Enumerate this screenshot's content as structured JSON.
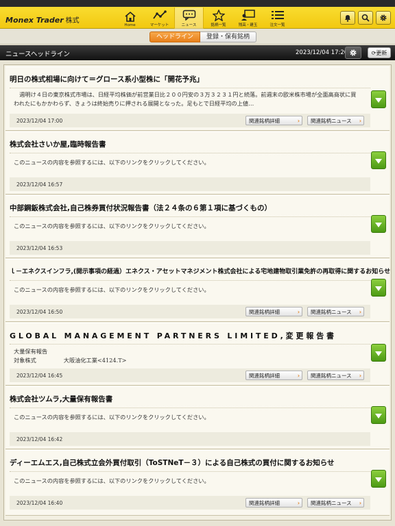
{
  "app": {
    "brand": "Monex Trader",
    "brand_sub": "株式"
  },
  "nav": [
    {
      "label": "Home",
      "icon": "home-icon"
    },
    {
      "label": "マーケット",
      "icon": "chart-line-icon"
    },
    {
      "label": "ニュース",
      "icon": "speech-bubble-icon",
      "active": true
    },
    {
      "label": "銘柄一覧",
      "icon": "star-icon"
    },
    {
      "label": "残高・建玉",
      "icon": "portfolio-icon"
    },
    {
      "label": "注文一覧",
      "icon": "list-icon"
    }
  ],
  "tools": [
    "bell-icon",
    "search-icon",
    "gear-icon"
  ],
  "subtabs": [
    "ヘッドライン",
    "登録・保有銘柄"
  ],
  "header": {
    "title": "ニュースヘッドライン",
    "time": "2023/12/04 17:20",
    "refresh": "更新"
  },
  "buttons": {
    "detail": "関連銘柄詳細",
    "news": "関連銘柄ニュース"
  },
  "news": [
    {
      "title": "明日の株式相場に向けて＝グロース系小型株に「開花予兆」",
      "body": "　週明け４日の東京株式市場は、日経平均株価が前営業日比２００円安の３万３２３１円と続落。前週末の欧米株市場が全面高商状に買われたにもかかわらず、きょうは終始売りに押される展開となった。足もとで日経平均の上値…",
      "time": "2023/12/04 17:00",
      "links": true
    },
    {
      "title": "株式会社さいか屋,臨時報告書",
      "body": "このニュースの内容を参照するには、以下のリンクをクリックしてください。",
      "time": "2023/12/04 16:57",
      "links": false
    },
    {
      "title": "中部鋼鈑株式会社,自己株券買付状況報告書（法２４条の６第１項に基づくもの）",
      "body": "このニュースの内容を参照するには、以下のリンクをクリックしてください。",
      "time": "2023/12/04 16:53",
      "links": false
    },
    {
      "title": "ｌ－エネクスインフラ,(開示事項の経過）エネクス・アセットマネジメント株式会社による宅地建物取引業免許の再取得に関するお知らせ",
      "body": "このニュースの内容を参照するには、以下のリンクをクリックしてください。",
      "time": "2023/12/04 16:50",
      "links": true
    },
    {
      "title": "GLOBAL MANAGEMENT PARTNERS LIMITED,変更報告書",
      "body_heading": "大量保有報告",
      "body_label": "対象株式",
      "body_value": "大阪油化工業<4124.T>",
      "time": "2023/12/04 16:45",
      "links": true
    },
    {
      "title": "株式会社ツムラ,大量保有報告書",
      "body": "このニュースの内容を参照するには、以下のリンクをクリックしてください。",
      "time": "2023/12/04 16:42",
      "links": false
    },
    {
      "title": "ディーエムエス,自己株式立会外買付取引（ToSTNeT－３）による自己株式の買付に関するお知らせ",
      "body": "このニュースの内容を参照するには、以下のリンクをクリックしてください。",
      "time": "2023/12/04 16:40",
      "links": true
    }
  ],
  "colors": {
    "accent": "#f2c811",
    "tab_active": "#e8801a",
    "expand": "#5fae1e"
  }
}
